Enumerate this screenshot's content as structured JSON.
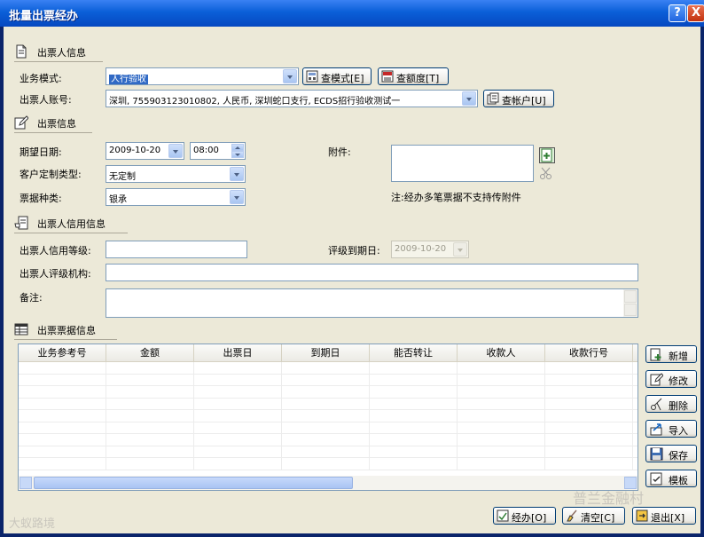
{
  "window": {
    "title": "批量出票经办",
    "help_icon": "?",
    "close_icon": "X"
  },
  "drawer_section": {
    "title": "出票人信息",
    "icon": "document-icon"
  },
  "business_mode": {
    "label": "业务模式:",
    "value": "人行验收",
    "button": "查模式[E]"
  },
  "drawer_account": {
    "label": "出票人账号:",
    "value": "深圳, 755903123010802, 人民币, 深圳蛇口支行, ECDS招行验收测试一",
    "button": "查帐户[U]"
  },
  "quota_button": "查额度[T]",
  "bill_section": {
    "title": "出票信息",
    "icon": "edit-icon"
  },
  "expected_date": {
    "label": "期望日期:",
    "date": "2009-10-20",
    "time": "08:00"
  },
  "custom_type": {
    "label": "客户定制类型:",
    "value": "无定制"
  },
  "bill_kind": {
    "label": "票据种类:",
    "value": "银承"
  },
  "attachment": {
    "label": "附件:",
    "note": "注:经办多笔票据不支持传附件"
  },
  "credit_section": {
    "title": "出票人信用信息",
    "icon": "hand-note-icon"
  },
  "credit_grade": {
    "label": "出票人信用等级:",
    "value": ""
  },
  "rating_expiry": {
    "label": "评级到期日:",
    "value": "2009-10-20"
  },
  "rating_agency": {
    "label": "出票人评级机构:",
    "value": ""
  },
  "remarks": {
    "label": "备注:",
    "value": ""
  },
  "grid_section": {
    "title": "出票票据信息",
    "icon": "table-icon"
  },
  "grid": {
    "columns": [
      "业务参考号",
      "金额",
      "出票日",
      "到期日",
      "能否转让",
      "收款人",
      "收款行号"
    ],
    "rows": []
  },
  "side_buttons": [
    "新增",
    "修改",
    "删除",
    "导入",
    "保存",
    "模板"
  ],
  "footer": {
    "submit": "经办[O]",
    "clear": "清空[C]",
    "exit": "退出[X]"
  },
  "watermarks": {
    "left": "大蚁路境",
    "right": "普兰金融村"
  },
  "colors": {
    "title_bar": "#0a5fd8",
    "dialog_bg": "#ece9d8",
    "selection": "#316ac5"
  }
}
